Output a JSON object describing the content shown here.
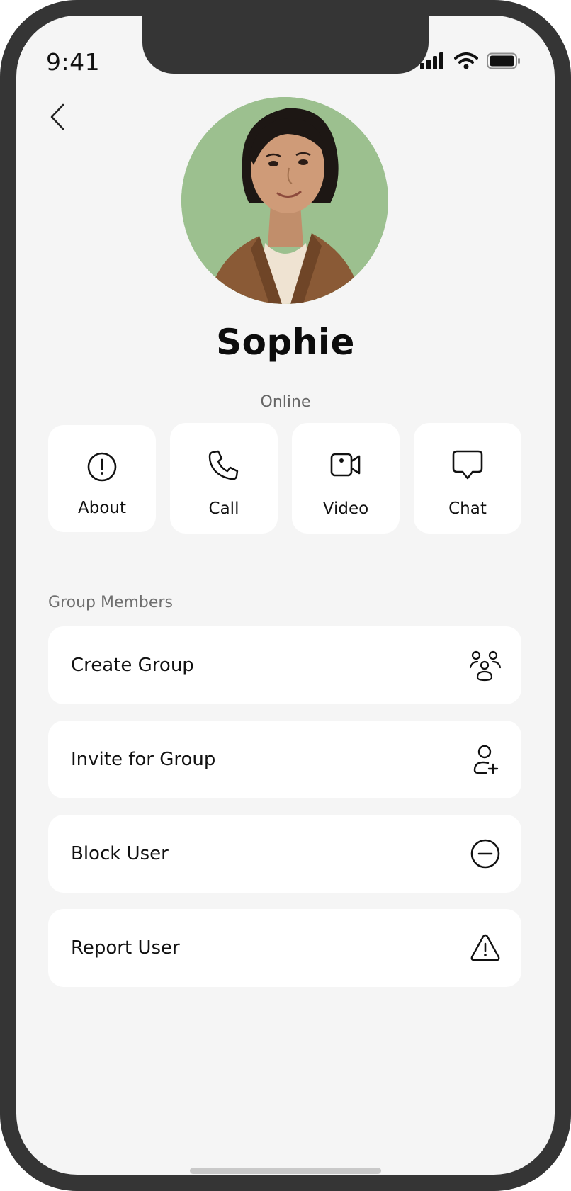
{
  "status_bar": {
    "time": "9:41"
  },
  "profile": {
    "name": "Sophie",
    "status": "Online"
  },
  "actions": [
    {
      "label": "About",
      "icon": "info-icon"
    },
    {
      "label": "Call",
      "icon": "phone-icon"
    },
    {
      "label": "Video",
      "icon": "video-icon"
    },
    {
      "label": "Chat",
      "icon": "chat-icon"
    }
  ],
  "section": {
    "title": "Group Members"
  },
  "menu": [
    {
      "label": "Create Group",
      "icon": "group-icon"
    },
    {
      "label": "Invite for Group",
      "icon": "add-user-icon"
    },
    {
      "label": "Block User",
      "icon": "block-icon"
    },
    {
      "label": "Report User",
      "icon": "warning-icon"
    }
  ],
  "colors": {
    "frame": "#353535",
    "screen_bg": "#f5f5f5",
    "card_bg": "#ffffff",
    "avatar_bg": "#9cc08f",
    "muted_text": "#6f6f6f"
  }
}
